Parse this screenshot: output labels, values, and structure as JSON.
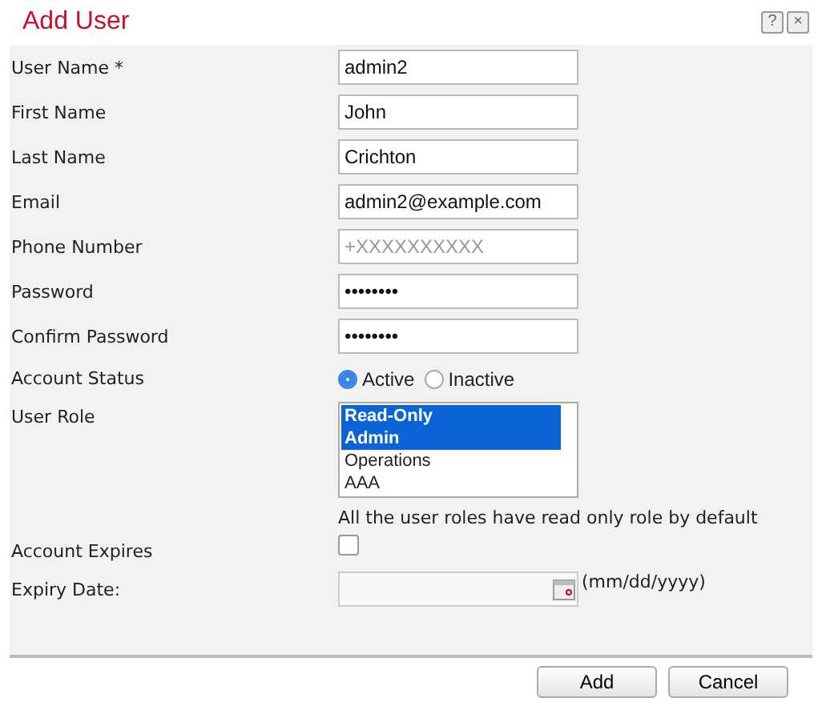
{
  "dialog": {
    "title": "Add User",
    "help": "?",
    "close": "×"
  },
  "fields": [
    {
      "kind": "text",
      "label": "User Name *",
      "value": "admin2"
    },
    {
      "kind": "text",
      "label": "First Name",
      "value": "John"
    },
    {
      "kind": "text",
      "label": "Last Name",
      "value": "Crichton"
    },
    {
      "kind": "text",
      "label": "Email",
      "value": "admin2@example.com"
    },
    {
      "kind": "text",
      "label": "Phone Number",
      "placeholder": "+XXXXXXXXXX"
    },
    {
      "kind": "text",
      "label": "Password",
      "value": "••••••••"
    },
    {
      "kind": "text",
      "label": "Confirm Password",
      "value": "••••••••"
    }
  ],
  "account_status": {
    "label": "Account Status",
    "options": [
      {
        "label": "Active",
        "selected": true
      },
      {
        "label": "Inactive",
        "selected": false
      }
    ]
  },
  "user_role": {
    "label": "User Role",
    "options": [
      {
        "label": "Read-Only",
        "selected": true
      },
      {
        "label": "Admin",
        "selected": true
      },
      {
        "label": "Operations",
        "selected": false
      },
      {
        "label": "AAA",
        "selected": false
      }
    ],
    "note": "All the user roles have read only role by default"
  },
  "account_expires": {
    "label": "Account Expires",
    "checked": false
  },
  "expiry_date": {
    "label": "Expiry Date:",
    "hint": "(mm/dd/yyyy)"
  },
  "buttons": [
    "Add",
    "Cancel"
  ]
}
